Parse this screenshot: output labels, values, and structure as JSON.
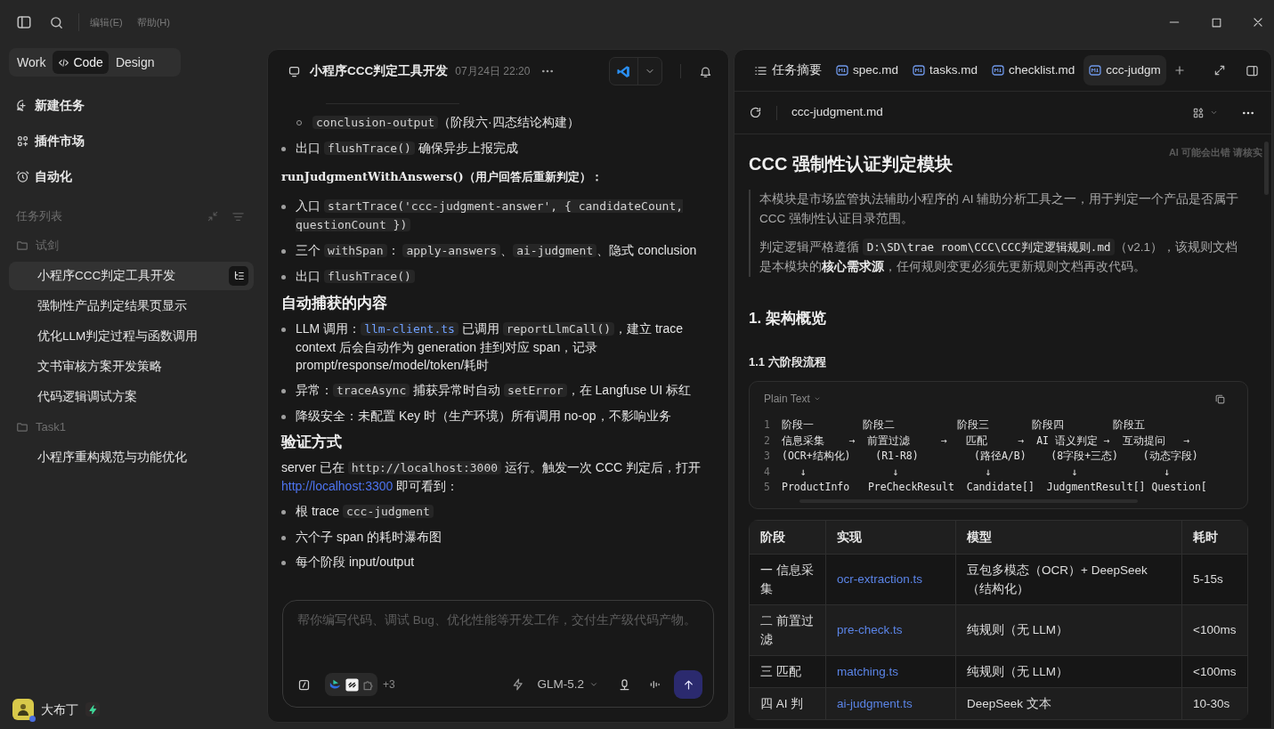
{
  "menu": [
    "编辑(E)",
    "帮助(H)"
  ],
  "modes": [
    {
      "label": "Work",
      "kind": "plain",
      "selected": false
    },
    {
      "label": "Code",
      "kind": "code",
      "selected": true
    },
    {
      "label": "Design",
      "kind": "plain",
      "selected": false
    }
  ],
  "nav": [
    {
      "label": "新建任务",
      "kind": "new"
    },
    {
      "label": "插件市场",
      "kind": "plugins"
    },
    {
      "label": "自动化",
      "kind": "automation"
    }
  ],
  "task_list": {
    "title": "任务列表",
    "folders": [
      {
        "name": "试剑",
        "children": [
          {
            "label": "小程序CCC判定工具开发",
            "selected": true
          },
          {
            "label": "强制性产品判定结果页显示",
            "selected": false
          },
          {
            "label": "优化LLM判定过程与函数调用",
            "selected": false
          },
          {
            "label": "文书审核方案开发策略",
            "selected": false
          },
          {
            "label": "代码逻辑调试方案",
            "selected": false
          }
        ]
      },
      {
        "name": "Task1",
        "children": [
          {
            "label": "小程序重构规范与功能优化",
            "selected": false
          }
        ]
      }
    ]
  },
  "user": {
    "name": "大布丁"
  },
  "chat": {
    "title": "小程序CCC判定工具开发",
    "time": "07月24日 22:20",
    "blocks": [
      {
        "kind": "sub_bullet",
        "parts": [
          {
            "kind": "code",
            "text": "conclusion-output"
          },
          {
            "kind": "text",
            "text": "（阶段六·四态结论构建）"
          }
        ]
      },
      {
        "kind": "bullet",
        "parts": [
          {
            "kind": "text",
            "text": "出口 "
          },
          {
            "kind": "code",
            "text": "flushTrace()"
          },
          {
            "kind": "text",
            "text": " 确保异步上报完成"
          }
        ]
      },
      {
        "kind": "code_heading",
        "parts": [
          {
            "kind": "text",
            "text": "runJudgmentWithAnswers()（用户回答后重新判定）："
          }
        ]
      },
      {
        "kind": "bullet",
        "parts": [
          {
            "kind": "text",
            "text": "入口 "
          },
          {
            "kind": "code",
            "text": "startTrace('ccc-judgment-answer', { candidateCount, questionCount })"
          }
        ]
      },
      {
        "kind": "bullet",
        "parts": [
          {
            "kind": "text",
            "text": "三个 "
          },
          {
            "kind": "code",
            "text": "withSpan"
          },
          {
            "kind": "text",
            "text": "： "
          },
          {
            "kind": "code",
            "text": "apply-answers"
          },
          {
            "kind": "text",
            "text": "、"
          },
          {
            "kind": "code",
            "text": "ai-judgment"
          },
          {
            "kind": "text",
            "text": "、隐式 conclusion"
          }
        ]
      },
      {
        "kind": "bullet",
        "parts": [
          {
            "kind": "text",
            "text": "出口 "
          },
          {
            "kind": "code",
            "text": "flushTrace()"
          }
        ]
      },
      {
        "kind": "heading",
        "parts": [
          {
            "kind": "text",
            "text": "自动捕获的内容"
          }
        ]
      },
      {
        "kind": "bullet",
        "parts": [
          {
            "kind": "text",
            "text": "LLM 调用："
          },
          {
            "kind": "code_link",
            "text": "llm-client.ts"
          },
          {
            "kind": "text",
            "text": " 已调用 "
          },
          {
            "kind": "code",
            "text": "reportLlmCall()"
          },
          {
            "kind": "text",
            "text": "，建立 trace context 后会自动作为 generation 挂到对应 span，记录 prompt/response/model/token/耗时"
          }
        ]
      },
      {
        "kind": "bullet",
        "parts": [
          {
            "kind": "text",
            "text": "异常："
          },
          {
            "kind": "code",
            "text": "traceAsync"
          },
          {
            "kind": "text",
            "text": " 捕获异常时自动 "
          },
          {
            "kind": "code",
            "text": "setError"
          },
          {
            "kind": "text",
            "text": "，在 Langfuse UI 标红"
          }
        ]
      },
      {
        "kind": "bullet",
        "parts": [
          {
            "kind": "text",
            "text": "降级安全：未配置 Key 时（生产环境）所有调用 no-op，不影响业务"
          }
        ]
      },
      {
        "kind": "heading",
        "parts": [
          {
            "kind": "text",
            "text": "验证方式"
          }
        ]
      },
      {
        "kind": "paragraph",
        "parts": [
          {
            "kind": "text",
            "text": "server 已在 "
          },
          {
            "kind": "code",
            "text": "http://localhost:3000"
          },
          {
            "kind": "text",
            "text": " 运行。触发一次 CCC 判定后，打开 "
          },
          {
            "kind": "link",
            "text": "http://localhost:3300"
          },
          {
            "kind": "text",
            "text": " 即可看到："
          }
        ]
      },
      {
        "kind": "bullet",
        "parts": [
          {
            "kind": "text",
            "text": "根 trace "
          },
          {
            "kind": "code",
            "text": "ccc-judgment"
          }
        ]
      },
      {
        "kind": "bullet",
        "parts": [
          {
            "kind": "text",
            "text": "六个子 span 的耗时瀑布图"
          }
        ]
      },
      {
        "kind": "bullet",
        "parts": [
          {
            "kind": "text",
            "text": "每个阶段 input/output"
          }
        ]
      }
    ],
    "input": {
      "placeholder": "帮你编写代码、调试 Bug、优化性能等开发工作，交付生产级代码产物。",
      "extra_tools": "+3",
      "model": "GLM-5.2"
    }
  },
  "doc": {
    "tabs": [
      {
        "label": "任务摘要",
        "kind": "summary",
        "selected": false
      },
      {
        "label": "spec.md",
        "kind": "file",
        "selected": false
      },
      {
        "label": "tasks.md",
        "kind": "file",
        "selected": false
      },
      {
        "label": "checklist.md",
        "kind": "file",
        "selected": false
      },
      {
        "label": "ccc-judgm",
        "kind": "file",
        "selected": true
      }
    ],
    "file_name": "ccc-judgment.md",
    "notice": "AI 可能会出错 请核实",
    "title": "CCC 强制性认证判定模块",
    "quote": [
      [
        {
          "kind": "text",
          "text": "本模块是市场监管执法辅助小程序的 AI 辅助分析工具之一，用于判定一个产品是否属于 CCC 强制性认证目录范围。"
        }
      ],
      [
        {
          "kind": "text",
          "text": "判定逻辑严格遵循 "
        },
        {
          "kind": "code",
          "text": "D:\\SD\\trae room\\CCC\\CCC判定逻辑规则.md"
        },
        {
          "kind": "text",
          "text": "（v2.1），该规则文档是本模块的"
        },
        {
          "kind": "bold",
          "text": "核心需求源"
        },
        {
          "kind": "text",
          "text": "，任何规则变更必须先更新规则文档再改代码。"
        }
      ]
    ],
    "h2": "1. 架构概览",
    "h3": "1.1 六阶段流程",
    "code": {
      "language": "Plain Text",
      "lines": [
        {
          "number": "1",
          "text": "阶段一        阶段二          阶段三       阶段四        阶段五"
        },
        {
          "number": "2",
          "text": "信息采集    →  前置过滤     →   匹配     →  AI 语义判定 →  互动提问   →"
        },
        {
          "number": "3",
          "text": "(OCR+结构化)    (R1-R8)         (路径A/B)    (8字段+三态)    (动态字段)"
        },
        {
          "number": "4",
          "text": "   ↓              ↓              ↓             ↓              ↓"
        },
        {
          "number": "5",
          "text": "ProductInfo   PreCheckResult  Candidate[]  JudgmentResult[] Question["
        }
      ]
    },
    "table": {
      "columns": [
        "阶段",
        "实现",
        "模型",
        "耗时"
      ],
      "rows": [
        [
          "一 信息采集",
          "ocr-extraction.ts",
          "豆包多模态（OCR）+ DeepSeek（结构化）",
          "5-15s"
        ],
        [
          "二 前置过滤",
          "pre-check.ts",
          "纯规则（无 LLM）",
          "<100ms"
        ],
        [
          "三 匹配",
          "matching.ts",
          "纯规则（无 LLM）",
          "<100ms"
        ],
        [
          "四 AI 判",
          "ai-judgment.ts",
          "DeepSeek 文本",
          "10-30s"
        ]
      ]
    }
  }
}
